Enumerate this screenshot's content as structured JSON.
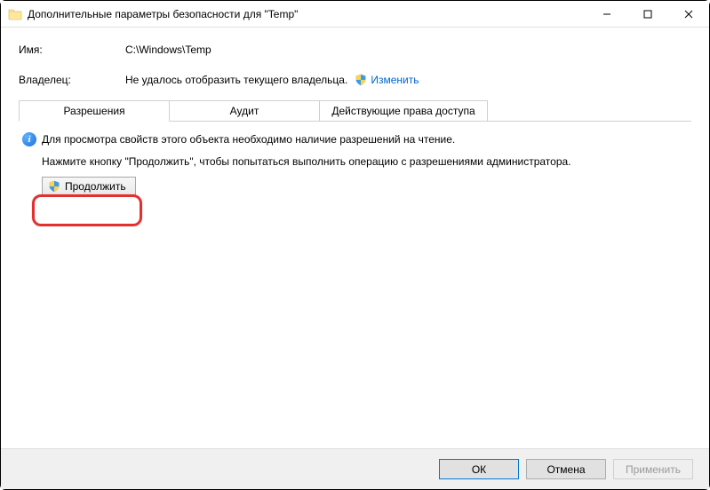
{
  "window": {
    "title": "Дополнительные параметры безопасности  для \"Temp\""
  },
  "fields": {
    "name_label": "Имя:",
    "name_value": "C:\\Windows\\Temp",
    "owner_label": "Владелец:",
    "owner_value": "Не удалось отобразить текущего владельца.",
    "change_link": "Изменить"
  },
  "tabs": {
    "permissions": "Разрешения",
    "audit": "Аудит",
    "effective": "Действующие права доступа"
  },
  "panel": {
    "info_text": "Для просмотра свойств этого объекта необходимо наличие разрешений на чтение.",
    "hint_text": "Нажмите кнопку \"Продолжить\", чтобы попытаться выполнить операцию с разрешениями администратора.",
    "continue_label": "Продолжить"
  },
  "footer": {
    "ok": "ОК",
    "cancel": "Отмена",
    "apply": "Применить"
  }
}
